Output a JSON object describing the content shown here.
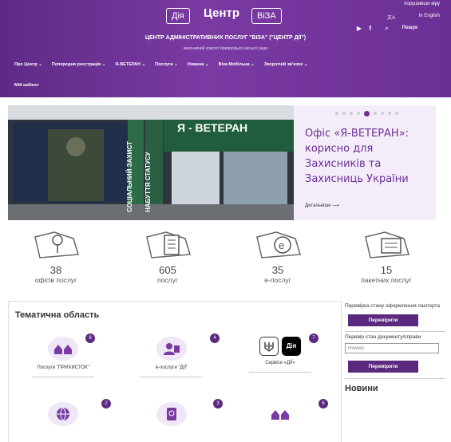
{
  "header": {
    "logo_left": "Дія",
    "logo_mid": "Центр",
    "logo_right": "ВіЗА",
    "top_right_text": "порушивши віру",
    "lang": "In English",
    "search": "Пошук",
    "title": "ЦЕНТР АДМІНІСТРАТИВНИХ ПОСЛУГ \"ВІЗА\" (\"ЦЕНТР ДІЇ\")",
    "subtitle": "виконавчий комітет Криворізької міської ради"
  },
  "nav": [
    "Про Центр ⌄",
    "Попередня реєстрація ⌄",
    "Я-ВЕТЕРАН ⌄",
    "Послуги ⌄",
    "Новини ⌄",
    "Віза Мобільна ⌄",
    "Зворотній зв'язок ⌄"
  ],
  "nav_cabinet": "Мій кабінет",
  "hero": {
    "title": "Офіс «Я-ВЕТЕРАН»: корисно для Захисників та Захисниць України",
    "more": "Детальніше ⟶",
    "banner_text": "Я - ВЕТЕРАН",
    "vertical_text_1": "СОЦІАЛЬНИЙ ЗАХИСТ",
    "vertical_text_2": "НАБУТТЯ СТАТУСУ"
  },
  "stats": [
    {
      "num": "38",
      "label": "офісів послуг"
    },
    {
      "num": "605",
      "label": "послуг"
    },
    {
      "num": "35",
      "label": "е-послуг"
    },
    {
      "num": "15",
      "label": "пакетних послуг"
    }
  ],
  "topics": {
    "title": "Тематична область",
    "tiles": [
      {
        "label": "Послуги \"ПРИХИСТОК\"",
        "badge": "8"
      },
      {
        "label": "е-послуги \"ДІЇ\"",
        "badge": "4"
      },
      {
        "label": "Сервіси «ДІЇ»",
        "badge": "7"
      },
      {
        "label": "",
        "badge": "2"
      },
      {
        "label": "",
        "badge": "3"
      },
      {
        "label": "",
        "badge": "6"
      }
    ]
  },
  "sidebar": {
    "passport_label": "Перевірка стану оформлення паспорта",
    "check_button": "Перевірити",
    "doc_label": "Перевір стан документу/справи",
    "number_placeholder": "Номер",
    "check_button_2": "Перевірити",
    "news_title": "Новини"
  },
  "colors": {
    "brand": "#6b2f95",
    "button": "#5b2a80"
  }
}
